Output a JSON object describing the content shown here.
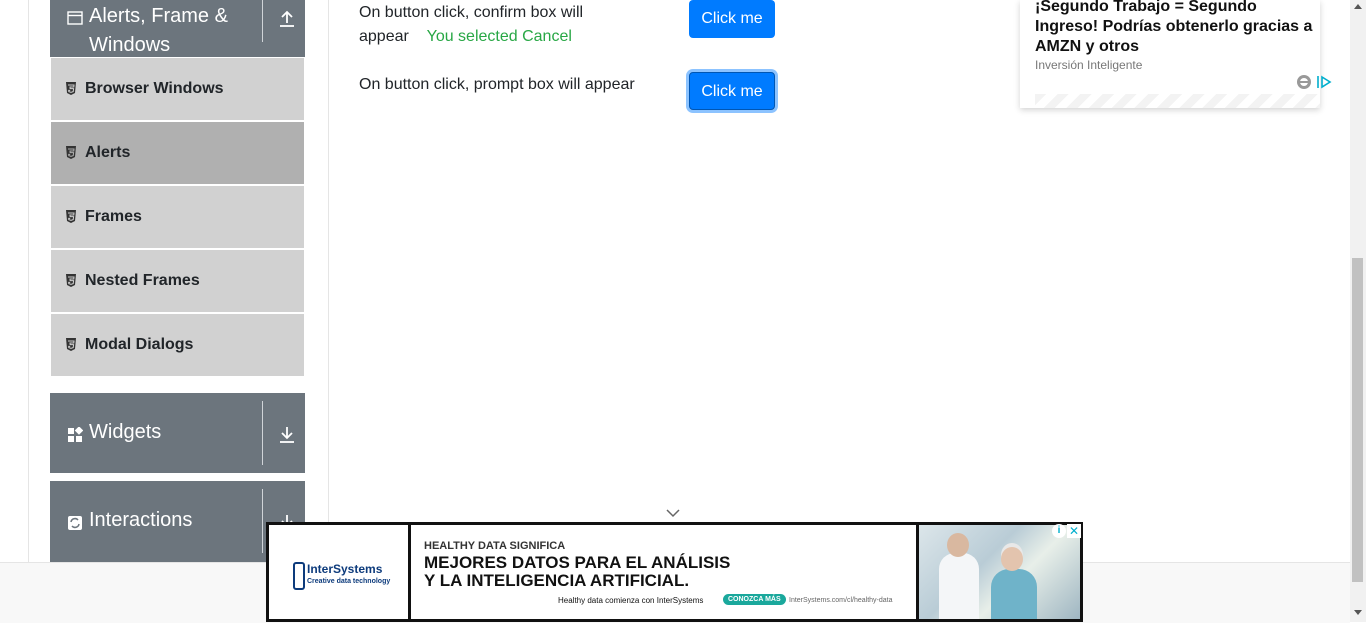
{
  "sidebar": {
    "groups": [
      {
        "label": "Alerts, Frame &\nWindows",
        "line1": "Alerts, Frame &",
        "line2": "Windows",
        "icon": "window-icon",
        "state": "expanded"
      },
      {
        "label": "Widgets",
        "icon": "widgets-icon",
        "state": "collapsed"
      },
      {
        "label": "Interactions",
        "icon": "interactions-icon",
        "state": "collapsed"
      }
    ],
    "items": [
      {
        "label": "Browser Windows"
      },
      {
        "label": "Alerts",
        "active": true
      },
      {
        "label": "Frames"
      },
      {
        "label": "Nested Frames"
      },
      {
        "label": "Modal Dialogs"
      }
    ]
  },
  "main": {
    "confirm_row": {
      "text_line1": "On button click, confirm box will",
      "text_line2": "appear",
      "result": "You selected Cancel",
      "button_label": "Click me"
    },
    "prompt_row": {
      "text": "On button click, prompt box will appear",
      "button_label": "Click me"
    }
  },
  "right_ad": {
    "headline": "¡Segundo Trabajo = Segundo Ingreso! Podrías obtenerlo gracias a AMZN y otros",
    "source": "Inversión Inteligente"
  },
  "banner_ad": {
    "brand": "InterSystems",
    "tagline": "Creative data technology",
    "eyebrow": "HEALTHY DATA SIGNIFICA",
    "headline_line1": "MEJORES DATOS PARA EL ANÁLISIS",
    "headline_line2": "Y LA INTELIGENCIA ARTIFICIAL.",
    "subline": "Healthy data comienza con InterSystems",
    "cta": "CONOZCA MÁS",
    "url": "InterSystems.com/cl/healthy-data"
  },
  "colors": {
    "sidebar_group_bg": "#6c757d",
    "menu_item_bg": "#d1d1d1",
    "menu_item_active_bg": "#b0b0b0",
    "button_bg": "#007bff",
    "result_text": "#28a745"
  }
}
